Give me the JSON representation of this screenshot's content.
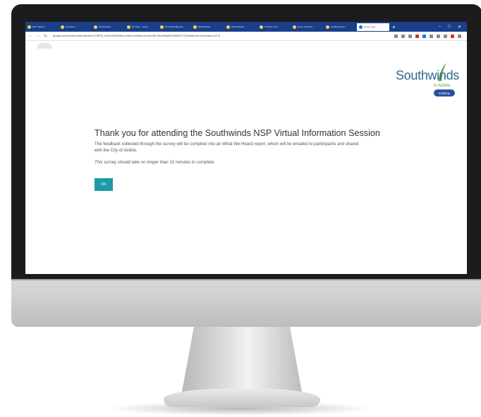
{
  "browser": {
    "tabs": [
      {
        "label": "ICTY Networ..."
      },
      {
        "label": "work item - ..."
      },
      {
        "label": "SI Facebook"
      },
      {
        "label": "HF Inbox - kathy..."
      },
      {
        "label": "HF Onboarding Ca..."
      },
      {
        "label": "Design Brief..."
      },
      {
        "label": "Informational..."
      },
      {
        "label": "Continue Your..."
      },
      {
        "label": "jamey (4 items)..."
      },
      {
        "label": "Update Survey..."
      },
      {
        "label": "survey sess...",
        "active": true
      }
    ],
    "new_tab": "+",
    "url": "google.com/security-reader/sandbox/1C5EDS_m02043f2909/key-reader+xmlbanp.chrome-8f4795c5ef8/y5642358c37170j?kbase/web.cloneulator-c2f7-8"
  },
  "logo": {
    "wordmark": "Southwinds",
    "subtitle": "in Airdrie",
    "badge": "surfamy",
    "leaf_color": "#6aa84f",
    "word_color": "#2d6a8a"
  },
  "content": {
    "headline": "Thank you for attending the Southwinds NSP Virtual Information Session",
    "intro": "The feedback collected through the survey will be compiled into an What We Heard report, which will be emailed to participants and shared with the City of Airdrie.",
    "note": "This survey should take no longer than 10 minutes to complete.",
    "ok_label": "OK",
    "accent_color": "#1c9aa6"
  }
}
